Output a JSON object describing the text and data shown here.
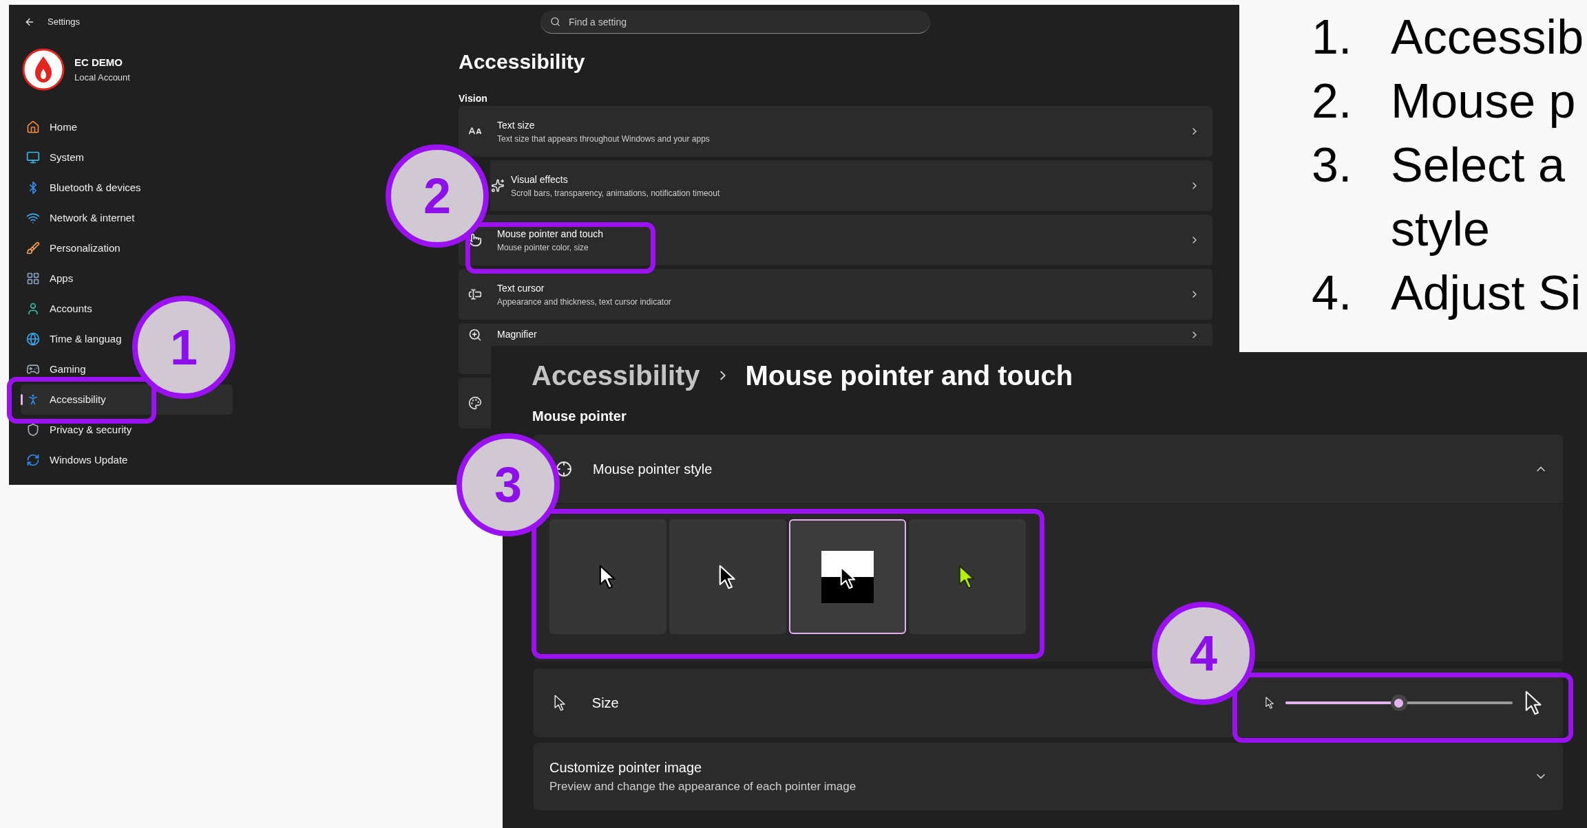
{
  "settings_window": {
    "title": "Settings",
    "search": {
      "placeholder": "Find a setting"
    },
    "account": {
      "name": "EC DEMO",
      "type": "Local Account"
    },
    "sidebar": {
      "items": [
        {
          "label": "Home",
          "selected": false
        },
        {
          "label": "System",
          "selected": false
        },
        {
          "label": "Bluetooth & devices",
          "selected": false
        },
        {
          "label": "Network & internet",
          "selected": false
        },
        {
          "label": "Personalization",
          "selected": false
        },
        {
          "label": "Apps",
          "selected": false
        },
        {
          "label": "Accounts",
          "selected": false
        },
        {
          "label": "Time & languag",
          "selected": false
        },
        {
          "label": "Gaming",
          "selected": false
        },
        {
          "label": "Accessibility",
          "selected": true
        },
        {
          "label": "Privacy & security",
          "selected": false
        },
        {
          "label": "Windows Update",
          "selected": false
        }
      ]
    },
    "page_title": "Accessibility",
    "section": "Vision",
    "cards": [
      {
        "title": "Text size",
        "subtitle": "Text size that appears throughout Windows and your apps"
      },
      {
        "title": "Visual effects",
        "subtitle": "Scroll bars, transparency, animations, notification timeout"
      },
      {
        "title": "Mouse pointer and touch",
        "subtitle": "Mouse pointer color, size"
      },
      {
        "title": "Text cursor",
        "subtitle": "Appearance and thickness, text cursor indicator"
      },
      {
        "title": "Magnifier"
      }
    ]
  },
  "detail_window": {
    "breadcrumb": {
      "parent": "Accessibility",
      "current": "Mouse pointer and touch"
    },
    "section": "Mouse pointer",
    "pointer_style": {
      "label": "Mouse pointer style",
      "expanded": true,
      "options": [
        {
          "kind": "white",
          "selected": false
        },
        {
          "kind": "black",
          "selected": false
        },
        {
          "kind": "inverted",
          "selected": true
        },
        {
          "kind": "custom",
          "selected": false
        }
      ]
    },
    "size": {
      "label": "Size",
      "level": 0.5
    },
    "customize": {
      "title": "Customize pointer image",
      "subtitle": "Preview and change the appearance of each pointer image",
      "expanded": false
    }
  },
  "steps": [
    {
      "number": "1.",
      "text": "Accessib"
    },
    {
      "number": "2.",
      "text": "Mouse p"
    },
    {
      "number": "3.",
      "text": "Select a style"
    },
    {
      "number": "4.",
      "text": "Adjust Si"
    }
  ],
  "callouts": [
    {
      "number": "1"
    },
    {
      "number": "2"
    },
    {
      "number": "3"
    },
    {
      "number": "4"
    }
  ]
}
